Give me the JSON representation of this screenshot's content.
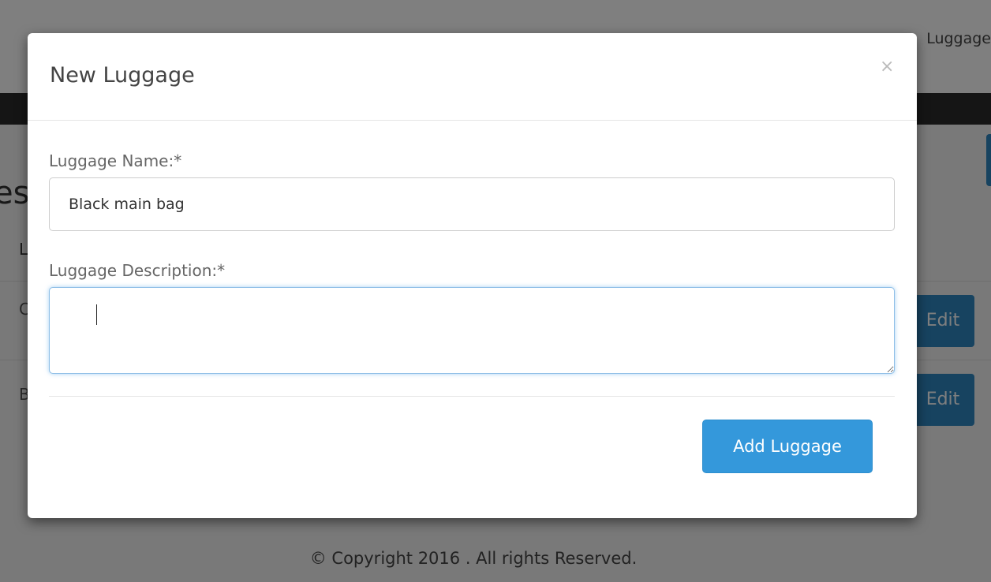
{
  "background": {
    "nav_link": "Luggage",
    "heading_fragment": "es",
    "column_header_fragment": "L",
    "rows": [
      {
        "text_fragment": "C",
        "edit_label": "Edit"
      },
      {
        "text_fragment": "B",
        "edit_label": "Edit"
      }
    ],
    "footer": "© Copyright 2016 . All rights Reserved."
  },
  "modal": {
    "title": "New Luggage",
    "close_symbol": "×",
    "name_label": "Luggage Name:*",
    "name_value": "Black main bag",
    "description_label": "Luggage Description:*",
    "description_value": "",
    "submit_label": "Add Luggage"
  },
  "colors": {
    "primary": "#3498db",
    "focus_border": "#8cbde6"
  }
}
